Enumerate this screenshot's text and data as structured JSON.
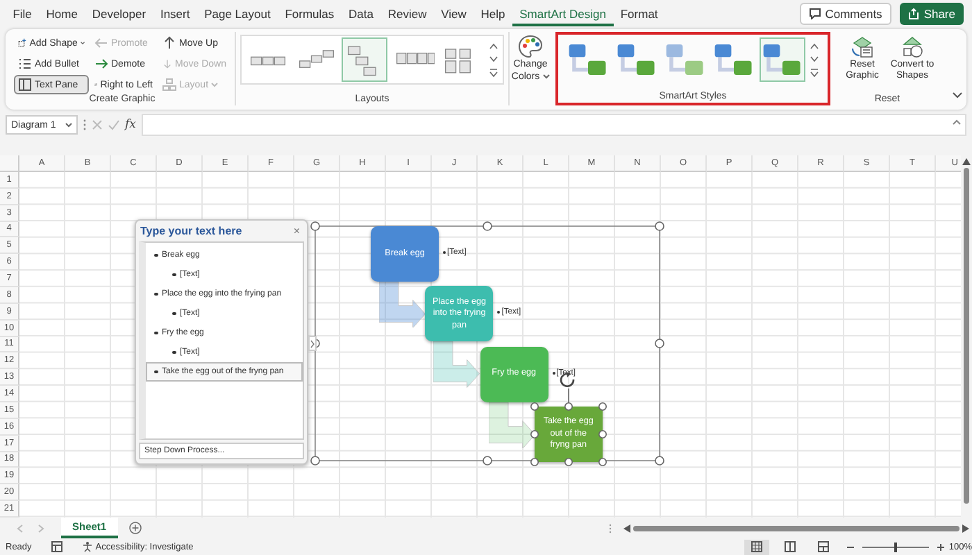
{
  "menu_tabs": [
    {
      "label": "File",
      "selected": false
    },
    {
      "label": "Home",
      "selected": false
    },
    {
      "label": "Developer",
      "selected": false
    },
    {
      "label": "Insert",
      "selected": false
    },
    {
      "label": "Page Layout",
      "selected": false
    },
    {
      "label": "Formulas",
      "selected": false
    },
    {
      "label": "Data",
      "selected": false
    },
    {
      "label": "Review",
      "selected": false
    },
    {
      "label": "View",
      "selected": false
    },
    {
      "label": "Help",
      "selected": false
    },
    {
      "label": "SmartArt Design",
      "selected": true
    },
    {
      "label": "Format",
      "selected": false
    }
  ],
  "comments_button": {
    "label": "Comments"
  },
  "share_button": {
    "label": "Share"
  },
  "ribbon": {
    "create_graphic": {
      "label": "Create Graphic",
      "buttons": [
        {
          "label": "Add Shape",
          "kind": "dropdown",
          "disabled": false,
          "pressed": false
        },
        {
          "label": "Promote",
          "kind": "button",
          "disabled": true,
          "pressed": false
        },
        {
          "label": "Move Up",
          "kind": "button",
          "disabled": false,
          "pressed": false
        },
        {
          "label": "Add Bullet",
          "kind": "button",
          "disabled": false,
          "pressed": false
        },
        {
          "label": "Demote",
          "kind": "button",
          "disabled": false,
          "pressed": false
        },
        {
          "label": "Move Down",
          "kind": "button",
          "disabled": true,
          "pressed": false
        },
        {
          "label": "Text Pane",
          "kind": "button",
          "disabled": false,
          "pressed": true
        },
        {
          "label": "Right to Left",
          "kind": "button",
          "disabled": false,
          "pressed": false
        },
        {
          "label": "Layout",
          "kind": "dropdown",
          "disabled": true,
          "pressed": false
        }
      ]
    },
    "layouts": {
      "label": "Layouts",
      "items": [
        {
          "selected": false
        },
        {
          "selected": false
        },
        {
          "selected": true
        },
        {
          "selected": false
        },
        {
          "selected": false
        }
      ]
    },
    "change_colors": {
      "label": "Change Colors"
    },
    "smartart_styles": {
      "label": "SmartArt Styles",
      "highlighted": true,
      "items": [
        {
          "selected": false
        },
        {
          "selected": false
        },
        {
          "selected": false
        },
        {
          "selected": false
        },
        {
          "selected": true
        }
      ]
    },
    "reset": {
      "label": "Reset",
      "buttons": [
        {
          "label": "Reset Graphic"
        },
        {
          "label": "Convert to Shapes"
        }
      ]
    }
  },
  "formula_bar": {
    "name_box": "Diagram 1",
    "function_label": "fx"
  },
  "sheet": {
    "columns": [
      "A",
      "B",
      "C",
      "D",
      "E",
      "F",
      "G",
      "H",
      "I",
      "J",
      "K",
      "L",
      "M",
      "N",
      "O",
      "P",
      "Q",
      "R",
      "S",
      "T",
      "U"
    ],
    "rows": [
      "1",
      "2",
      "3",
      "4",
      "5",
      "6",
      "7",
      "8",
      "9",
      "10",
      "11",
      "12",
      "13",
      "14",
      "15",
      "16",
      "17",
      "18",
      "19",
      "20",
      "21"
    ]
  },
  "text_pane": {
    "title": "Type your text here",
    "close": "×",
    "footer": "Step Down Process...",
    "items": [
      {
        "text": "Break egg",
        "selected": false,
        "children": [
          {
            "text": "[Text]",
            "selected": false
          }
        ]
      },
      {
        "text": "Place the egg into the frying pan",
        "selected": false,
        "children": [
          {
            "text": "[Text]",
            "selected": false
          }
        ]
      },
      {
        "text": "Fry the egg",
        "selected": false,
        "children": [
          {
            "text": "[Text]",
            "selected": false
          }
        ]
      },
      {
        "text": "Take the egg out of the fryng pan",
        "selected": true
      }
    ]
  },
  "diagram": {
    "steps": [
      {
        "text": "Break egg",
        "note": "[Text]",
        "color": "#4a89d4",
        "selected": false
      },
      {
        "text": "Place the egg into the frying pan",
        "note": "[Text]",
        "color": "#3dbdae",
        "selected": false
      },
      {
        "text": "Fry the egg",
        "note": "[Text]",
        "color": "#4cba55",
        "selected": false
      },
      {
        "text": "Take the egg out of the fryng pan",
        "color": "#68a83a",
        "selected": true
      }
    ]
  },
  "sheet_tabs": [
    {
      "label": "Sheet1",
      "selected": true
    }
  ],
  "status_bar": {
    "ready": "Ready",
    "accessibility": "Accessibility: Investigate",
    "views": [
      {
        "selected": true
      },
      {
        "selected": false
      },
      {
        "selected": false
      }
    ],
    "zoom": {
      "level": 0.5,
      "reading": "100%"
    }
  }
}
